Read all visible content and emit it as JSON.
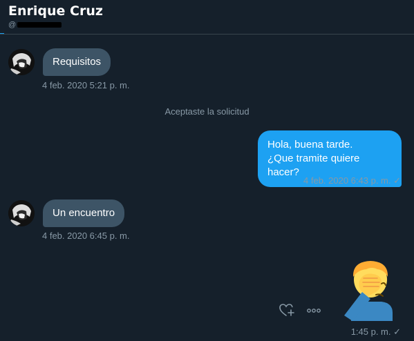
{
  "header": {
    "name": "Enrique Cruz",
    "handle_prefix": "@"
  },
  "messages": [
    {
      "text": "Requisitos",
      "timestamp": "4 feb. 2020 5:21 p. m."
    },
    {
      "system": "Aceptaste la solicitud"
    },
    {
      "line1": "Hola, buena tarde.",
      "line2": "¿Que tramite quiere hacer?",
      "timestamp": "4 feb. 2020 6:43 p. m. ✓"
    },
    {
      "text": "Un encuentro",
      "timestamp": "4 feb. 2020 6:45 p. m."
    },
    {
      "emoji": "facepalm",
      "timestamp": "1:45 p. m. ✓"
    }
  ],
  "colors": {
    "background": "#15202b",
    "incoming_bubble": "#3d5466",
    "outgoing_bubble": "#1da1f2",
    "muted_text": "#8899a6"
  }
}
